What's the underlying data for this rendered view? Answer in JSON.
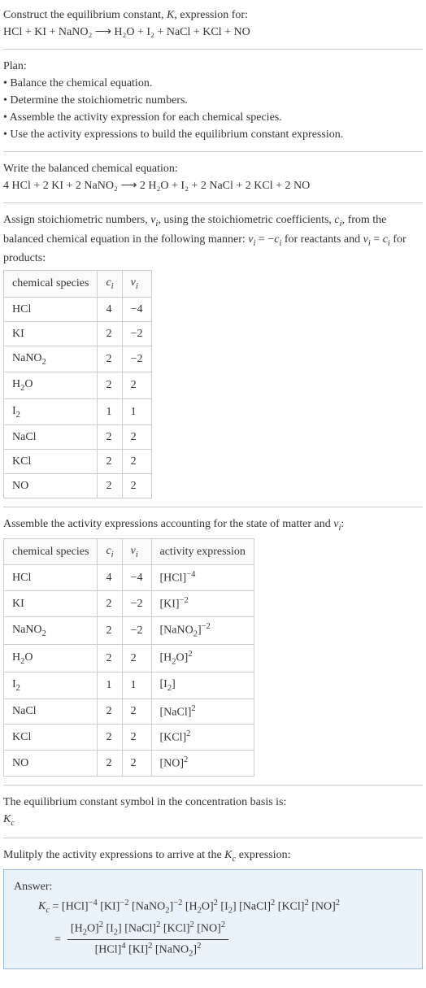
{
  "intro": {
    "construct": "Construct the equilibrium constant, K, expression for:",
    "equation": "HCl + KI + NaNO₂ ⟶ H₂O + I₂ + NaCl + KCl + NO"
  },
  "plan": {
    "title": "Plan:",
    "items": [
      "• Balance the chemical equation.",
      "• Determine the stoichiometric numbers.",
      "• Assemble the activity expression for each chemical species.",
      "• Use the activity expressions to build the equilibrium constant expression."
    ]
  },
  "balanced": {
    "title": "Write the balanced chemical equation:",
    "equation": "4 HCl + 2 KI + 2 NaNO₂ ⟶ 2 H₂O + I₂ + 2 NaCl + 2 KCl + 2 NO"
  },
  "stoich": {
    "text1": "Assign stoichiometric numbers, νᵢ, using the stoichiometric coefficients, cᵢ, from the balanced chemical equation in the following manner: νᵢ = −cᵢ for reactants and νᵢ = cᵢ for products:",
    "headers": [
      "chemical species",
      "cᵢ",
      "νᵢ"
    ],
    "rows": [
      [
        "HCl",
        "4",
        "−4"
      ],
      [
        "KI",
        "2",
        "−2"
      ],
      [
        "NaNO₂",
        "2",
        "−2"
      ],
      [
        "H₂O",
        "2",
        "2"
      ],
      [
        "I₂",
        "1",
        "1"
      ],
      [
        "NaCl",
        "2",
        "2"
      ],
      [
        "KCl",
        "2",
        "2"
      ],
      [
        "NO",
        "2",
        "2"
      ]
    ]
  },
  "activity": {
    "title": "Assemble the activity expressions accounting for the state of matter and νᵢ:",
    "headers": [
      "chemical species",
      "cᵢ",
      "νᵢ",
      "activity expression"
    ],
    "rows": [
      [
        "HCl",
        "4",
        "−4",
        "[HCl]⁻⁴"
      ],
      [
        "KI",
        "2",
        "−2",
        "[KI]⁻²"
      ],
      [
        "NaNO₂",
        "2",
        "−2",
        "[NaNO₂]⁻²"
      ],
      [
        "H₂O",
        "2",
        "2",
        "[H₂O]²"
      ],
      [
        "I₂",
        "1",
        "1",
        "[I₂]"
      ],
      [
        "NaCl",
        "2",
        "2",
        "[NaCl]²"
      ],
      [
        "KCl",
        "2",
        "2",
        "[KCl]²"
      ],
      [
        "NO",
        "2",
        "2",
        "[NO]²"
      ]
    ]
  },
  "symbol": {
    "title": "The equilibrium constant symbol in the concentration basis is:",
    "value": "K_c"
  },
  "multiply": {
    "title": "Mulitply the activity expressions to arrive at the K_c expression:"
  },
  "answer": {
    "label": "Answer:",
    "line1": "K_c = [HCl]⁻⁴ [KI]⁻² [NaNO₂]⁻² [H₂O]² [I₂] [NaCl]² [KCl]² [NO]²",
    "eq": "=",
    "num": "[H₂O]² [I₂] [NaCl]² [KCl]² [NO]²",
    "den": "[HCl]⁴ [KI]² [NaNO₂]²"
  },
  "chart_data": {
    "type": "table",
    "tables": [
      {
        "title": "Stoichiometric numbers",
        "columns": [
          "chemical species",
          "c_i",
          "nu_i"
        ],
        "rows": [
          {
            "chemical species": "HCl",
            "c_i": 4,
            "nu_i": -4
          },
          {
            "chemical species": "KI",
            "c_i": 2,
            "nu_i": -2
          },
          {
            "chemical species": "NaNO2",
            "c_i": 2,
            "nu_i": -2
          },
          {
            "chemical species": "H2O",
            "c_i": 2,
            "nu_i": 2
          },
          {
            "chemical species": "I2",
            "c_i": 1,
            "nu_i": 1
          },
          {
            "chemical species": "NaCl",
            "c_i": 2,
            "nu_i": 2
          },
          {
            "chemical species": "KCl",
            "c_i": 2,
            "nu_i": 2
          },
          {
            "chemical species": "NO",
            "c_i": 2,
            "nu_i": 2
          }
        ]
      },
      {
        "title": "Activity expressions",
        "columns": [
          "chemical species",
          "c_i",
          "nu_i",
          "activity expression"
        ],
        "rows": [
          {
            "chemical species": "HCl",
            "c_i": 4,
            "nu_i": -4,
            "activity expression": "[HCl]^-4"
          },
          {
            "chemical species": "KI",
            "c_i": 2,
            "nu_i": -2,
            "activity expression": "[KI]^-2"
          },
          {
            "chemical species": "NaNO2",
            "c_i": 2,
            "nu_i": -2,
            "activity expression": "[NaNO2]^-2"
          },
          {
            "chemical species": "H2O",
            "c_i": 2,
            "nu_i": 2,
            "activity expression": "[H2O]^2"
          },
          {
            "chemical species": "I2",
            "c_i": 1,
            "nu_i": 1,
            "activity expression": "[I2]"
          },
          {
            "chemical species": "NaCl",
            "c_i": 2,
            "nu_i": 2,
            "activity expression": "[NaCl]^2"
          },
          {
            "chemical species": "KCl",
            "c_i": 2,
            "nu_i": 2,
            "activity expression": "[KCl]^2"
          },
          {
            "chemical species": "NO",
            "c_i": 2,
            "nu_i": 2,
            "activity expression": "[NO]^2"
          }
        ]
      }
    ]
  }
}
